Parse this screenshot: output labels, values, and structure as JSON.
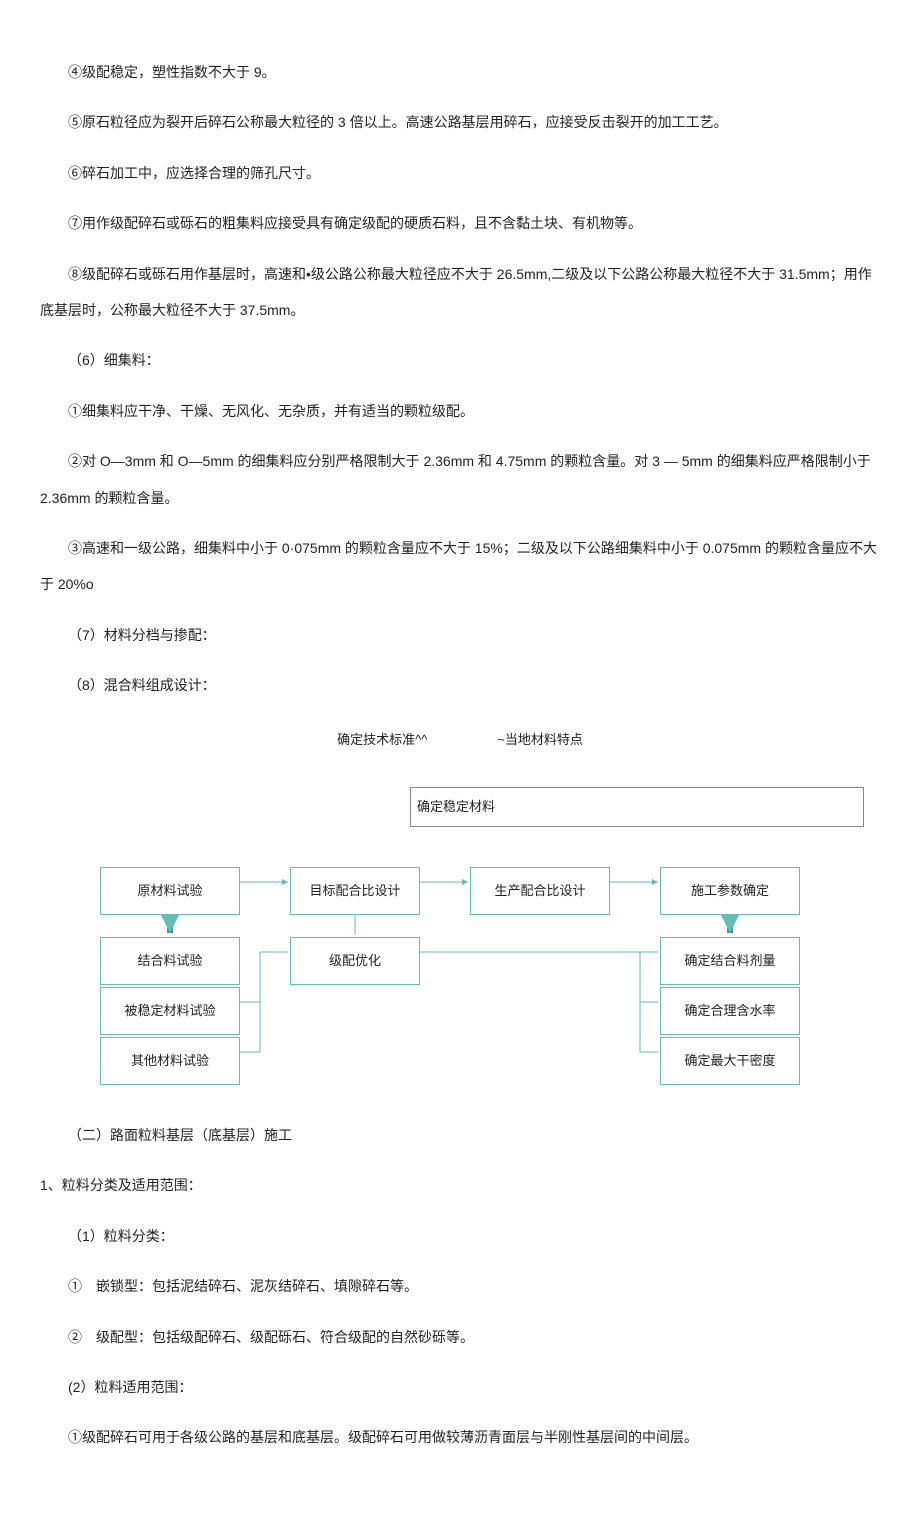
{
  "p1": "④级配稳定，塑性指数不大于 9。",
  "p2": "⑤原石粒径应为裂开后碎石公称最大粒径的 3 倍以上。高速公路基层用碎石，应接受反击裂开的加工工艺。",
  "p3": "⑥碎石加工中，应选择合理的筛孔尺寸。",
  "p4": "⑦用作级配碎石或砾石的粗集料应接受具有确定级配的硬质石料，且不含黏土块、有机物等。",
  "p5": "⑧级配碎石或砾石用作基层时，高速和•级公路公称最大粒径应不大于 26.5mm,二级及以下公路公称最大粒径不大于 31.5mm；用作底基层时，公称最大粒径不大于 37.5mm。",
  "p6": "（6）细集料：",
  "p7": "①细集料应干净、干燥、无风化、无杂质，并有适当的颗粒级配。",
  "p8": "②对 O—3mm 和 O—5mm 的细集料应分别严格限制大于 2.36mm 和 4.75mm 的颗粒含量。对 3 — 5mm 的细集料应严格限制小于 2.36mm 的颗粒含量。",
  "p9": "③高速和一级公路，细集料中小于 0·075mm 的颗粒含量应不大于 15%；二级及以下公路细集料中小于 0.075mm 的颗粒含量应不大于 20%o",
  "p10": "（7）材料分档与掺配：",
  "p11": "（8）混合料组成设计：",
  "ft1": "确定技术标准^^",
  "ft2": "~当地材料特点",
  "boxlong": "确定稳定材料",
  "n11": "原材料试验",
  "n12": "目标配合比设计",
  "n13": "生产配合比设计",
  "n14": "施工参数确定",
  "n21": "结合料试验",
  "n22": "级配优化",
  "n24": "确定结合料剂量",
  "n31": "被稳定材料试验",
  "n34": "确定合理含水率",
  "n41": "其他材料试验",
  "n44": "确定最大干密度",
  "h2": "（二）路面粒料基层（底基层）施工",
  "p12": "1、粒料分类及适用范围：",
  "p13": "（1）粒料分类：",
  "p14": "①　嵌锁型：包括泥结碎石、泥灰结碎石、填隙碎石等。",
  "p15": "②　级配型：包括级配碎石、级配砾石、符合级配的自然砂砾等。",
  "p16": "(2）粒料适用范围：",
  "p17": "①级配碎石可用于各级公路的基层和底基层。级配碎石可用做较薄沥青面层与半刚性基层间的中间层。"
}
